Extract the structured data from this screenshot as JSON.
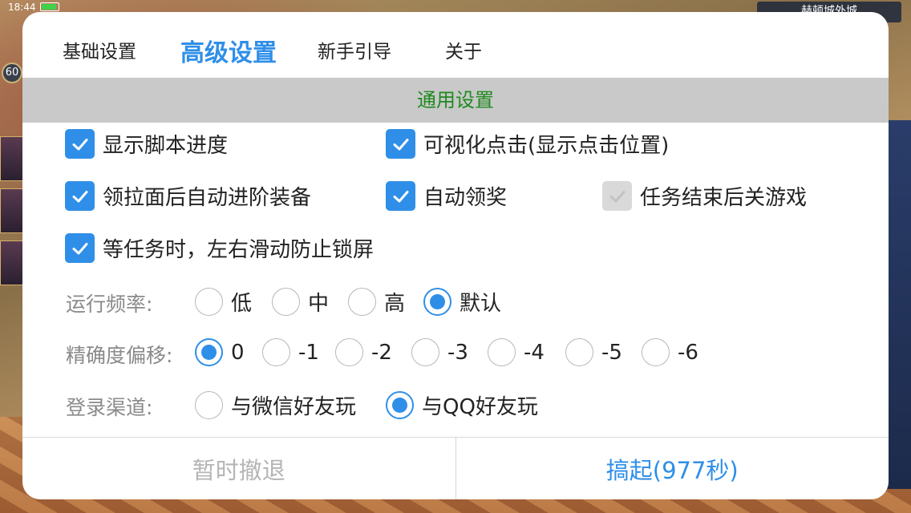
{
  "status_bar": {
    "time": "18:44"
  },
  "game": {
    "player_level": "60",
    "map_title": "赫顿城外城"
  },
  "tabs": [
    {
      "label": "基础设置",
      "active": false
    },
    {
      "label": "高级设置",
      "active": true
    },
    {
      "label": "新手引导",
      "active": false
    },
    {
      "label": "关于",
      "active": false
    }
  ],
  "section": {
    "title": "通用设置"
  },
  "checkboxes": [
    {
      "label": "显示脚本进度",
      "checked": true,
      "enabled": true
    },
    {
      "label": "可视化点击(显示点击位置)",
      "checked": true,
      "enabled": true
    },
    {
      "label": "领拉面后自动进阶装备",
      "checked": true,
      "enabled": true
    },
    {
      "label": "自动领奖",
      "checked": true,
      "enabled": true
    },
    {
      "label": "任务结束后关游戏",
      "checked": true,
      "enabled": false
    },
    {
      "label": "等任务时，左右滑动防止锁屏",
      "checked": true,
      "enabled": true
    }
  ],
  "run_frequency": {
    "label": "运行频率:",
    "options": [
      "低",
      "中",
      "高",
      "默认"
    ],
    "selected": "默认"
  },
  "precision_offset": {
    "label": "精确度偏移:",
    "options": [
      "0",
      "-1",
      "-2",
      "-3",
      "-4",
      "-5",
      "-6"
    ],
    "selected": "0"
  },
  "login_channel": {
    "label": "登录渠道:",
    "options": [
      "与微信好友玩",
      "与QQ好友玩"
    ],
    "selected": "与QQ好友玩"
  },
  "footer": {
    "retreat_label": "暂时撤退",
    "start_label": "搞起(977秒)"
  },
  "colors": {
    "accent": "#2f8fe8",
    "section_header_bg": "#c9c9c9",
    "section_header_text": "#1f8a1f",
    "disabled_checkbox": "#d9d9d9"
  }
}
